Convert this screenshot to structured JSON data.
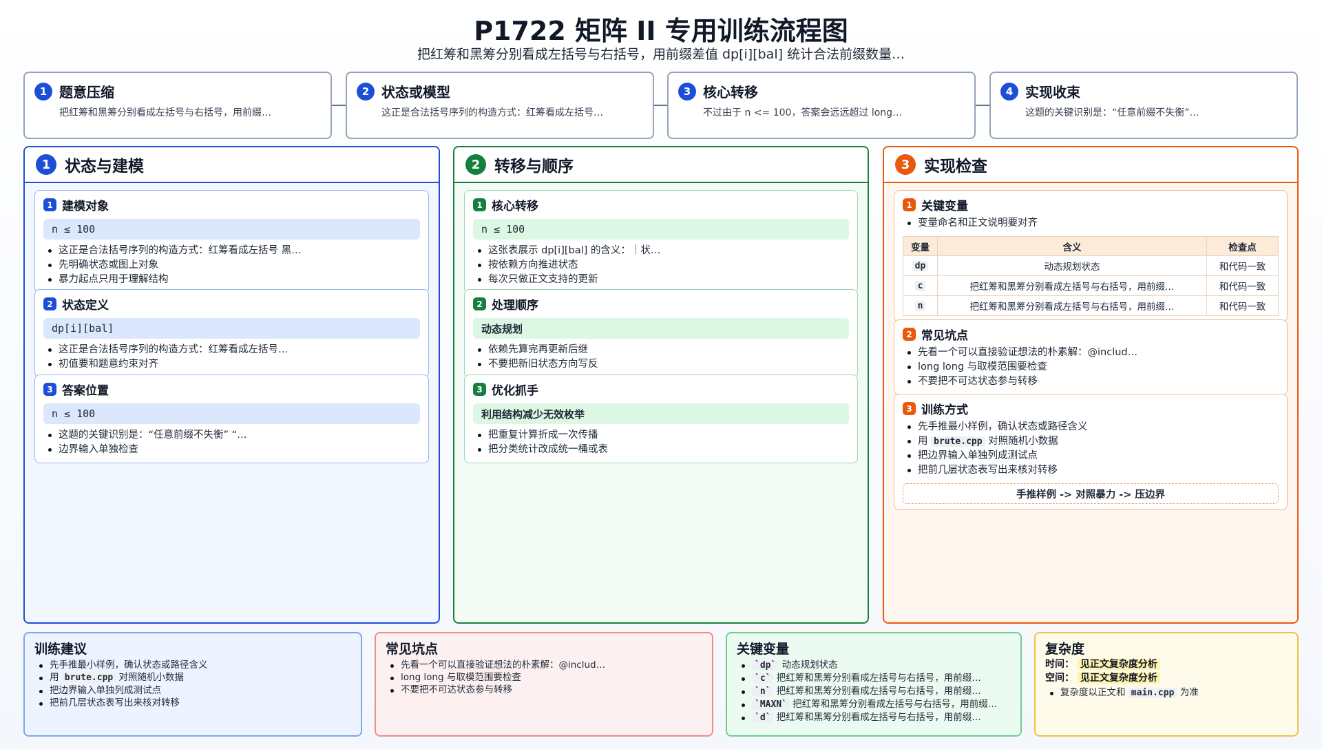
{
  "title": "P1722 矩阵 II 专用训练流程图",
  "subtitle": "把红筹和黑筹分别看成左括号与右括号，用前缀差值 dp[i][bal] 统计合法前缀数量…",
  "steps": [
    {
      "num": "1",
      "title": "题意压缩",
      "desc": "把红筹和黑筹分别看成左括号与右括号，用前缀…"
    },
    {
      "num": "2",
      "title": "状态或模型",
      "desc": "这正是合法括号序列的构造方式：红筹看成左括号…"
    },
    {
      "num": "3",
      "title": "核心转移",
      "desc": "不过由于 n <= 100，答案会远远超过 long…"
    },
    {
      "num": "4",
      "title": "实现收束",
      "desc": "这题的关键识别是：“任意前缀不失衡”…"
    }
  ],
  "col1": {
    "num": "1",
    "title": "状态与建模",
    "cards": [
      {
        "num": "1",
        "title": "建模对象",
        "code": "n ≤ 100",
        "bullets": [
          "这正是合法括号序列的构造方式：红筹看成左括号 黑…",
          "先明确状态或图上对象",
          "暴力起点只用于理解结构"
        ]
      },
      {
        "num": "2",
        "title": "状态定义",
        "code": "dp[i][bal]",
        "bullets": [
          "这正是合法括号序列的构造方式：红筹看成左括号…",
          "初值要和题意约束对齐"
        ]
      },
      {
        "num": "3",
        "title": "答案位置",
        "code": "n ≤ 100",
        "bullets": [
          "这题的关键识别是：“任意前缀不失衡” “…",
          "边界输入单独检查"
        ]
      }
    ]
  },
  "col2": {
    "num": "2",
    "title": "转移与顺序",
    "cards": [
      {
        "num": "1",
        "title": "核心转移",
        "code": "n ≤ 100",
        "bullets": [
          "这张表展示 dp[i][bal] 的含义：｜状…",
          "按依赖方向推进状态",
          "每次只做正文支持的更新"
        ]
      },
      {
        "num": "2",
        "title": "处理顺序",
        "code": "动态规划",
        "bullets": [
          "依赖先算完再更新后继",
          "不要把新旧状态方向写反"
        ]
      },
      {
        "num": "3",
        "title": "优化抓手",
        "code": "利用结构减少无效枚举",
        "bullets": [
          "把重复计算折成一次传播",
          "把分类统计改成统一桶或表"
        ]
      }
    ]
  },
  "col3": {
    "num": "3",
    "title": "实现检查",
    "vars_card": {
      "num": "1",
      "title": "关键变量",
      "bullet": "变量命名和正文说明要对齐",
      "headers": [
        "变量",
        "含义",
        "检查点"
      ],
      "rows": [
        {
          "k": "dp",
          "m": "动态规划状态",
          "c": "和代码一致"
        },
        {
          "k": "c",
          "m": "把红筹和黑筹分别看成左括号与右括号，用前缀…",
          "c": "和代码一致"
        },
        {
          "k": "n",
          "m": "把红筹和黑筹分别看成左括号与右括号，用前缀…",
          "c": "和代码一致"
        }
      ]
    },
    "pit_card": {
      "num": "2",
      "title": "常见坑点",
      "bullets": [
        "先看一个可以直接验证想法的朴素解：@includ…",
        "long long 与取模范围要检查",
        "不要把不可达状态参与转移"
      ]
    },
    "train_card": {
      "num": "3",
      "title": "训练方式",
      "b1": "先手推最小样例，确认状态或路径含义",
      "b2_pre": "用",
      "b2_code": "brute.cpp",
      "b2_post": "对照随机小数据",
      "b3": "把边界输入单独列成测试点",
      "b4": "把前几层状态表写出来核对转移",
      "flow": "手推样例 -> 对照暴力 -> 压边界"
    }
  },
  "bottom": {
    "train": {
      "title": "训练建议",
      "b1": "先手推最小样例，确认状态或路径含义",
      "b2_pre": "用",
      "b2_code": "brute.cpp",
      "b2_post": "对照随机小数据",
      "b3": "把边界输入单独列成测试点",
      "b4": "把前几层状态表写出来核对转移"
    },
    "pits": {
      "title": "常见坑点",
      "bullets": [
        "先看一个可以直接验证想法的朴素解：@includ…",
        "long long 与取模范围要检查",
        "不要把不可达状态参与转移"
      ]
    },
    "vars": {
      "title": "关键变量",
      "items": [
        {
          "k": "`dp`",
          "v": "动态规划状态"
        },
        {
          "k": "`c`",
          "v": "把红筹和黑筹分别看成左括号与右括号，用前缀…"
        },
        {
          "k": "`n`",
          "v": "把红筹和黑筹分别看成左括号与右括号，用前缀…"
        },
        {
          "k": "`MAXN`",
          "v": "把红筹和黑筹分别看成左括号与右括号，用前缀…"
        },
        {
          "k": "`d`",
          "v": "把红筹和黑筹分别看成左括号与右括号，用前缀…"
        }
      ]
    },
    "complexity": {
      "title": "复杂度",
      "time_label": "时间：",
      "time_value": "见正文复杂度分析",
      "space_label": "空间：",
      "space_value": "见正文复杂度分析",
      "note_pre": "复杂度以正文和",
      "note_code": "main.cpp",
      "note_post": "为准"
    }
  }
}
